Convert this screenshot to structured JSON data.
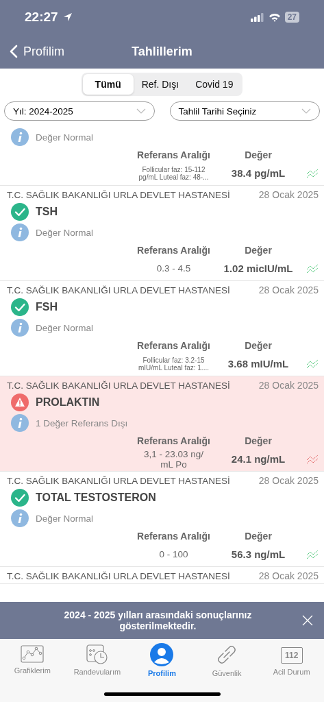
{
  "status_bar": {
    "time": "22:27",
    "battery": "27"
  },
  "nav": {
    "back": "Profilim",
    "title": "Tahlillerim"
  },
  "segments": [
    {
      "label": "Tümü",
      "selected": true
    },
    {
      "label": "Ref. Dışı",
      "selected": false
    },
    {
      "label": "Covid 19",
      "selected": false
    }
  ],
  "filters": [
    {
      "value": "Yıl: 2024-2025"
    },
    {
      "value": "Tahlil Tarihi Seçiniz"
    }
  ],
  "results": [
    {
      "out_of_range": false,
      "info": "Değer Normal",
      "ref_label": "Referans Aralığı",
      "value_label": "Değer",
      "ref": "Follicular faz: 15-112 pg/mL Luteal faz: 48-...",
      "value": "38.4 pg/mL"
    },
    {
      "hospital": "T.C. SAĞLIK BAKANLIĞI URLA DEVLET HASTANESİ",
      "date": "28 Ocak 2025",
      "name": "TSH",
      "out_of_range": false,
      "info": "Değer Normal",
      "ref_label": "Referans Aralığı",
      "value_label": "Değer",
      "ref": "0.3 - 4.5",
      "value": "1.02 micIU/mL"
    },
    {
      "hospital": "T.C. SAĞLIK BAKANLIĞI URLA DEVLET HASTANESİ",
      "date": "28 Ocak 2025",
      "name": "FSH",
      "out_of_range": false,
      "info": "Değer Normal",
      "ref_label": "Referans Aralığı",
      "value_label": "Değer",
      "ref": "Follicular faz: 3.2-15 mIU/mL Luteal faz: 1....",
      "value": "3.68 mIU/mL"
    },
    {
      "hospital": "T.C. SAĞLIK BAKANLIĞI URLA DEVLET HASTANESİ",
      "date": "28 Ocak 2025",
      "name": "PROLAKTIN",
      "out_of_range": true,
      "info": "1 Değer Referans Dışı",
      "ref_label": "Referans Aralığı",
      "value_label": "Değer",
      "ref": "3,1 - 23.03 ng/ mL Po",
      "value": "24.1 ng/mL"
    },
    {
      "hospital": "T.C. SAĞLIK BAKANLIĞI URLA DEVLET HASTANESİ",
      "date": "28 Ocak 2025",
      "name": "TOTAL TESTOSTERON",
      "out_of_range": false,
      "info": "Değer Normal",
      "ref_label": "Referans Aralığı",
      "value_label": "Değer",
      "ref": "0 - 100",
      "value": "56.3 ng/mL"
    },
    {
      "hospital": "T.C. SAĞLIK BAKANLIĞI URLA DEVLET HASTANESİ",
      "date": "28 Ocak 2025"
    }
  ],
  "banner": {
    "text": "2024 - 2025 yılları arasındaki sonuçlarınız gösterilmektedir."
  },
  "tab_bar": [
    {
      "kind": "chart",
      "label": "Grafiklerim",
      "selected": false
    },
    {
      "kind": "calendar",
      "label": "Randevularım",
      "selected": false
    },
    {
      "kind": "person",
      "label": "Profilim",
      "selected": true
    },
    {
      "kind": "link",
      "label": "Güvenlik",
      "selected": false
    },
    {
      "kind": "emergency",
      "label": "Acil Durum",
      "icon_text": "112",
      "selected": false
    }
  ]
}
